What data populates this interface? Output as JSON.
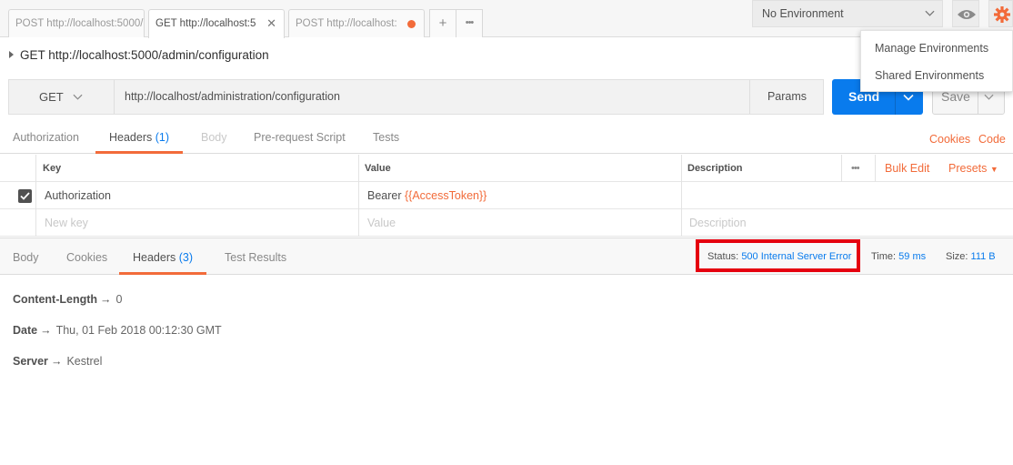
{
  "tabs": [
    {
      "label": "POST http://localhost:5000/"
    },
    {
      "label": "GET http://localhost:5"
    },
    {
      "label": "POST http://localhost:"
    }
  ],
  "tab_actions": {
    "add": "+",
    "more": "•••"
  },
  "environment": {
    "selected": "No Environment"
  },
  "env_menu": {
    "manage": "Manage Environments",
    "shared": "Shared Environments"
  },
  "request": {
    "title": "GET http://localhost:5000/admin/configuration",
    "method": "GET",
    "url": "http://localhost/administration/configuration",
    "params_label": "Params",
    "send_label": "Send",
    "save_label": "Save"
  },
  "request_tabs": {
    "authorization": "Authorization",
    "headers": "Headers",
    "headers_count": "(1)",
    "body": "Body",
    "prerequest": "Pre-request Script",
    "tests": "Tests",
    "cookies": "Cookies",
    "code": "Code"
  },
  "headers_table": {
    "col_key": "Key",
    "col_value": "Value",
    "col_description": "Description",
    "more": "•••",
    "bulk_edit": "Bulk Edit",
    "presets": "Presets",
    "rows": [
      {
        "key": "Authorization",
        "value_prefix": "Bearer ",
        "value_var": "{{AccessToken}}"
      }
    ],
    "new_key_placeholder": "New key",
    "value_placeholder": "Value",
    "description_placeholder": "Description"
  },
  "response_tabs": {
    "body": "Body",
    "cookies": "Cookies",
    "headers": "Headers",
    "headers_count": "(3)",
    "test_results": "Test Results"
  },
  "response_meta": {
    "status_label": "Status:",
    "status_value": "500 Internal Server Error",
    "time_label": "Time:",
    "time_value": "59 ms",
    "size_label": "Size:",
    "size_value": "111 B"
  },
  "response_headers": [
    {
      "key": "Content-Length",
      "value": "0"
    },
    {
      "key": "Date",
      "value": "Thu, 01 Feb 2018 00:12:30 GMT"
    },
    {
      "key": "Server",
      "value": "Kestrel"
    }
  ],
  "colors": {
    "accent": "#f26b3a",
    "primary": "#097bed",
    "highlight": "#e5000f"
  }
}
